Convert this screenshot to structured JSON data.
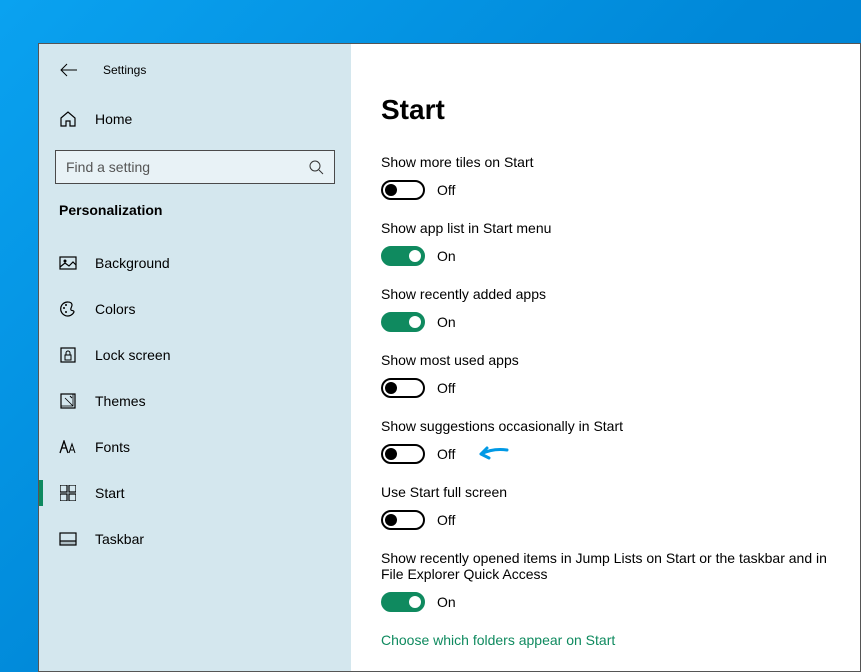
{
  "window": {
    "title": "Settings"
  },
  "sidebar": {
    "home_label": "Home",
    "search_placeholder": "Find a setting",
    "section_header": "Personalization",
    "nav": [
      {
        "label": "Background",
        "active": false,
        "icon": "picture"
      },
      {
        "label": "Colors",
        "active": false,
        "icon": "palette"
      },
      {
        "label": "Lock screen",
        "active": false,
        "icon": "lock-frame"
      },
      {
        "label": "Themes",
        "active": false,
        "icon": "themes"
      },
      {
        "label": "Fonts",
        "active": false,
        "icon": "fonts"
      },
      {
        "label": "Start",
        "active": true,
        "icon": "start"
      },
      {
        "label": "Taskbar",
        "active": false,
        "icon": "taskbar"
      }
    ]
  },
  "page": {
    "title": "Start",
    "settings": [
      {
        "label": "Show more tiles on Start",
        "state": "Off",
        "on": false
      },
      {
        "label": "Show app list in Start menu",
        "state": "On",
        "on": true
      },
      {
        "label": "Show recently added apps",
        "state": "On",
        "on": true
      },
      {
        "label": "Show most used apps",
        "state": "Off",
        "on": false
      },
      {
        "label": "Show suggestions occasionally in Start",
        "state": "Off",
        "on": false,
        "annotated": true
      },
      {
        "label": "Use Start full screen",
        "state": "Off",
        "on": false
      },
      {
        "label": "Show recently opened items in Jump Lists on Start or the taskbar and in File Explorer Quick Access",
        "state": "On",
        "on": true
      }
    ],
    "link": "Choose which folders appear on Start"
  },
  "colors": {
    "accent": "#0f8a5f",
    "sidebar_bg": "#d4e7ee",
    "desktop": "#0098e8",
    "annotation": "#0099e5"
  }
}
